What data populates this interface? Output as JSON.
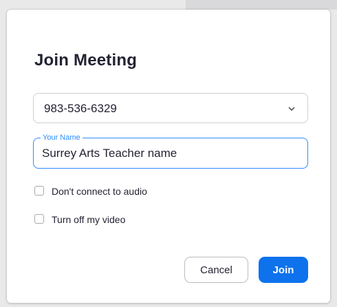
{
  "dialog": {
    "title": "Join Meeting"
  },
  "meeting_id": {
    "value": "983-536-6329",
    "icon": "chevron-down-icon"
  },
  "name_field": {
    "label": "Your Name",
    "value": "Surrey Arts Teacher name"
  },
  "options": {
    "audio": {
      "label": "Don't connect to audio",
      "checked": false
    },
    "video": {
      "label": "Turn off my video",
      "checked": false
    }
  },
  "buttons": {
    "cancel": "Cancel",
    "join": "Join"
  },
  "colors": {
    "accent": "#0e72ed",
    "focus": "#2d8cff",
    "text": "#232333"
  }
}
